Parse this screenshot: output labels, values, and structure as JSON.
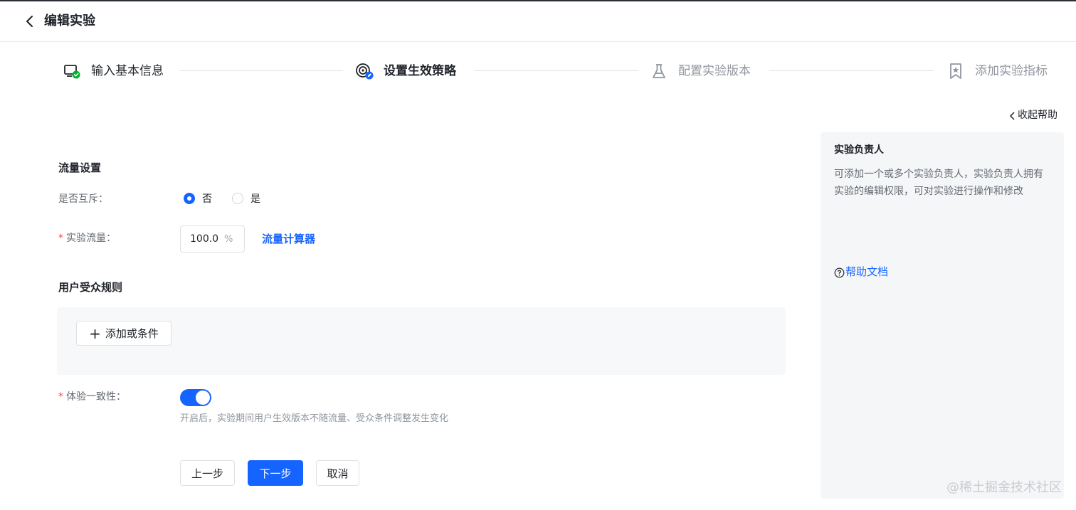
{
  "header": {
    "title": "编辑实验"
  },
  "steps": [
    {
      "label": "输入基本信息",
      "state": "done",
      "icon": "monitor-check-icon"
    },
    {
      "label": "设置生效策略",
      "state": "active",
      "icon": "target-edit-icon"
    },
    {
      "label": "配置实验版本",
      "state": "todo",
      "icon": "flask-icon"
    },
    {
      "label": "添加实验指标",
      "state": "todo",
      "icon": "bookmark-star-icon"
    }
  ],
  "help": {
    "collapse_label": "收起帮助",
    "title": "实验负责人",
    "description": "可添加一个或多个实验负责人，实验负责人拥有实验的编辑权限，可对实验进行操作和修改",
    "doc_link": "帮助文档"
  },
  "traffic": {
    "section_title": "流量设置",
    "mutex_label": "是否互斥：",
    "mutex_options": [
      "否",
      "是"
    ],
    "mutex_selected": "否",
    "flow_label": "实验流量：",
    "flow_value": "100.0",
    "flow_unit": "%",
    "calc_link": "流量计算器"
  },
  "audience": {
    "section_title": "用户受众规则",
    "add_or_label": "添加或条件"
  },
  "consistency": {
    "label": "体验一致性：",
    "enabled": true,
    "hint": "开启后，实验期间用户生效版本不随流量、受众条件调整发生变化"
  },
  "actions": {
    "prev_label": "上一步",
    "next_label": "下一步",
    "cancel_label": "取消"
  },
  "watermark": "@稀土掘金技术社区",
  "colors": {
    "primary": "#1664ff",
    "required": "#f54a45",
    "success": "#00b42a"
  }
}
